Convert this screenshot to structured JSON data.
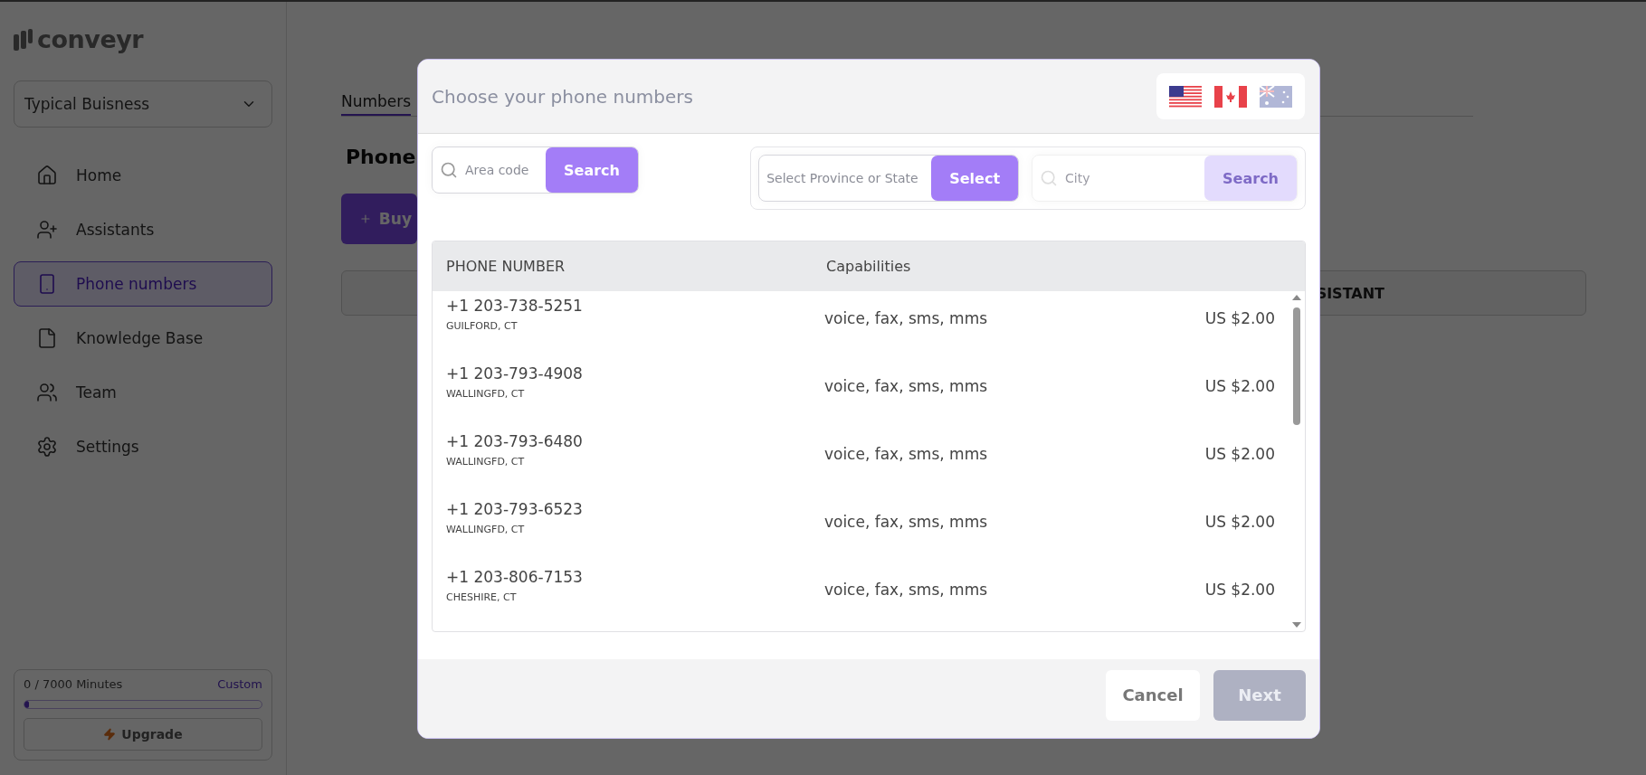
{
  "sidebar": {
    "logo": "conveyr",
    "workspace": "Typical Buisness",
    "items": [
      {
        "label": "Home",
        "kind": "home",
        "selected": false
      },
      {
        "label": "Assistants",
        "kind": "assistants",
        "selected": false
      },
      {
        "label": "Phone numbers",
        "kind": "phone",
        "selected": true
      },
      {
        "label": "Knowledge Base",
        "kind": "knowledge",
        "selected": false
      },
      {
        "label": "Team",
        "kind": "team",
        "selected": false
      },
      {
        "label": "Settings",
        "kind": "settings",
        "selected": false
      }
    ],
    "usage": {
      "label": "0 / 7000 Minutes",
      "plan": "Custom",
      "level": 0.02,
      "upgrade": "Upgrade"
    }
  },
  "main": {
    "tab": "Numbers",
    "heading": "Phone",
    "buy_button": "Buy",
    "table_header": "SISTANT"
  },
  "modal": {
    "title": "Choose your phone numbers",
    "flags": [
      {
        "kind": "us",
        "disabled": false
      },
      {
        "kind": "ca",
        "disabled": false
      },
      {
        "kind": "au",
        "disabled": true
      }
    ],
    "area_code": {
      "placeholder": "Area code",
      "button": "Search"
    },
    "province": {
      "placeholder": "Select Province or State",
      "button": "Select"
    },
    "city": {
      "placeholder": "City",
      "button": "Search",
      "disabled": true
    },
    "columns": [
      "PHONE NUMBER",
      "Capabilities"
    ],
    "rows": [
      {
        "number": "+1 203-738-5251",
        "location": "GUILFORD, CT",
        "capabilities": "voice, fax, sms, mms",
        "price": "US $2.00"
      },
      {
        "number": "+1 203-793-4908",
        "location": "WALLINGFD, CT",
        "capabilities": "voice, fax, sms, mms",
        "price": "US $2.00"
      },
      {
        "number": "+1 203-793-6480",
        "location": "WALLINGFD, CT",
        "capabilities": "voice, fax, sms, mms",
        "price": "US $2.00"
      },
      {
        "number": "+1 203-793-6523",
        "location": "WALLINGFD, CT",
        "capabilities": "voice, fax, sms, mms",
        "price": "US $2.00"
      },
      {
        "number": "+1 203-806-7153",
        "location": "CHESHIRE, CT",
        "capabilities": "voice, fax, sms, mms",
        "price": "US $2.00"
      }
    ],
    "cancel": "Cancel",
    "next": {
      "label": "Next",
      "disabled": true
    }
  }
}
